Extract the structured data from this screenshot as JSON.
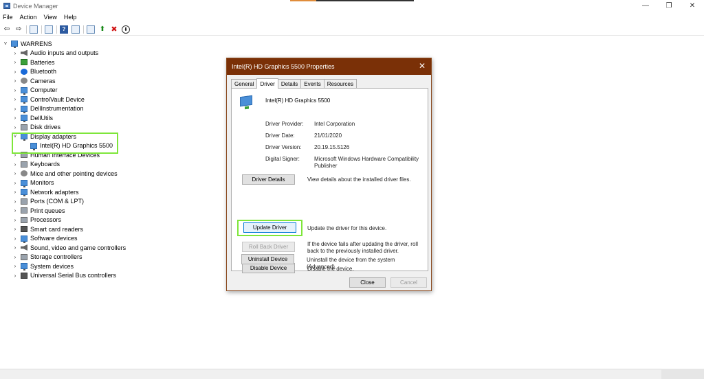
{
  "window": {
    "title": "Device Manager",
    "controls": {
      "minimize": "—",
      "restore": "❐",
      "close": "✕"
    }
  },
  "menu": [
    "File",
    "Action",
    "View",
    "Help"
  ],
  "tree": {
    "root": "WARRENS",
    "items": [
      {
        "label": "Audio inputs and outputs",
        "icon": "speaker-icon",
        "expanded": false
      },
      {
        "label": "Batteries",
        "icon": "battery-icon",
        "expanded": false
      },
      {
        "label": "Bluetooth",
        "icon": "bluetooth-icon",
        "expanded": false
      },
      {
        "label": "Cameras",
        "icon": "camera-icon",
        "expanded": false
      },
      {
        "label": "Computer",
        "icon": "computer-icon",
        "expanded": false
      },
      {
        "label": "ControlVault Device",
        "icon": "device-icon",
        "expanded": false
      },
      {
        "label": "DellInstrumentation",
        "icon": "device-icon",
        "expanded": false
      },
      {
        "label": "DellUtils",
        "icon": "device-icon",
        "expanded": false
      },
      {
        "label": "Disk drives",
        "icon": "disk-icon",
        "expanded": false
      },
      {
        "label": "Display adapters",
        "icon": "display-adapter-icon",
        "expanded": true,
        "children": [
          {
            "label": "Intel(R) HD Graphics 5500",
            "icon": "display-adapter-icon"
          }
        ]
      },
      {
        "label": "Human Interface Devices",
        "icon": "hid-icon",
        "expanded": false
      },
      {
        "label": "Keyboards",
        "icon": "keyboard-icon",
        "expanded": false
      },
      {
        "label": "Mice and other pointing devices",
        "icon": "mouse-icon",
        "expanded": false
      },
      {
        "label": "Monitors",
        "icon": "monitor-icon",
        "expanded": false
      },
      {
        "label": "Network adapters",
        "icon": "network-icon",
        "expanded": false
      },
      {
        "label": "Ports (COM & LPT)",
        "icon": "port-icon",
        "expanded": false
      },
      {
        "label": "Print queues",
        "icon": "printer-icon",
        "expanded": false
      },
      {
        "label": "Processors",
        "icon": "processor-icon",
        "expanded": false
      },
      {
        "label": "Smart card readers",
        "icon": "smart-card-icon",
        "expanded": false
      },
      {
        "label": "Software devices",
        "icon": "device-icon",
        "expanded": false
      },
      {
        "label": "Sound, video and game controllers",
        "icon": "speaker-icon",
        "expanded": false
      },
      {
        "label": "Storage controllers",
        "icon": "storage-icon",
        "expanded": false
      },
      {
        "label": "System devices",
        "icon": "system-icon",
        "expanded": false
      },
      {
        "label": "Universal Serial Bus controllers",
        "icon": "usb-icon",
        "expanded": false
      }
    ]
  },
  "dialog": {
    "title": "Intel(R) HD Graphics 5500 Properties",
    "tabs": [
      "General",
      "Driver",
      "Details",
      "Events",
      "Resources"
    ],
    "active_tab": "Driver",
    "device_name": "Intel(R) HD Graphics 5500",
    "properties": [
      {
        "label": "Driver Provider:",
        "value": "Intel Corporation"
      },
      {
        "label": "Driver Date:",
        "value": "21/01/2020"
      },
      {
        "label": "Driver Version:",
        "value": "20.19.15.5126"
      },
      {
        "label": "Digital Signer:",
        "value": "Microsoft Windows Hardware Compatibility Publisher"
      }
    ],
    "buttons": [
      {
        "label": "Driver Details",
        "desc": "View details about the installed driver files.",
        "enabled": true
      },
      {
        "label": "Update Driver",
        "desc": "Update the driver for this device.",
        "enabled": true
      },
      {
        "label": "Roll Back Driver",
        "desc": "If the device fails after updating the driver, roll back to the previously installed driver.",
        "enabled": false
      },
      {
        "label": "Disable Device",
        "desc": "Disable the device.",
        "enabled": true
      },
      {
        "label": "Uninstall Device",
        "desc": "Uninstall the device from the system (Advanced).",
        "enabled": true
      }
    ],
    "footer": {
      "close": "Close",
      "cancel": "Cancel"
    }
  },
  "colors": {
    "dialog_title_bg": "#7a3007",
    "highlight": "#7ee63a",
    "focus_border": "#0078d7"
  }
}
